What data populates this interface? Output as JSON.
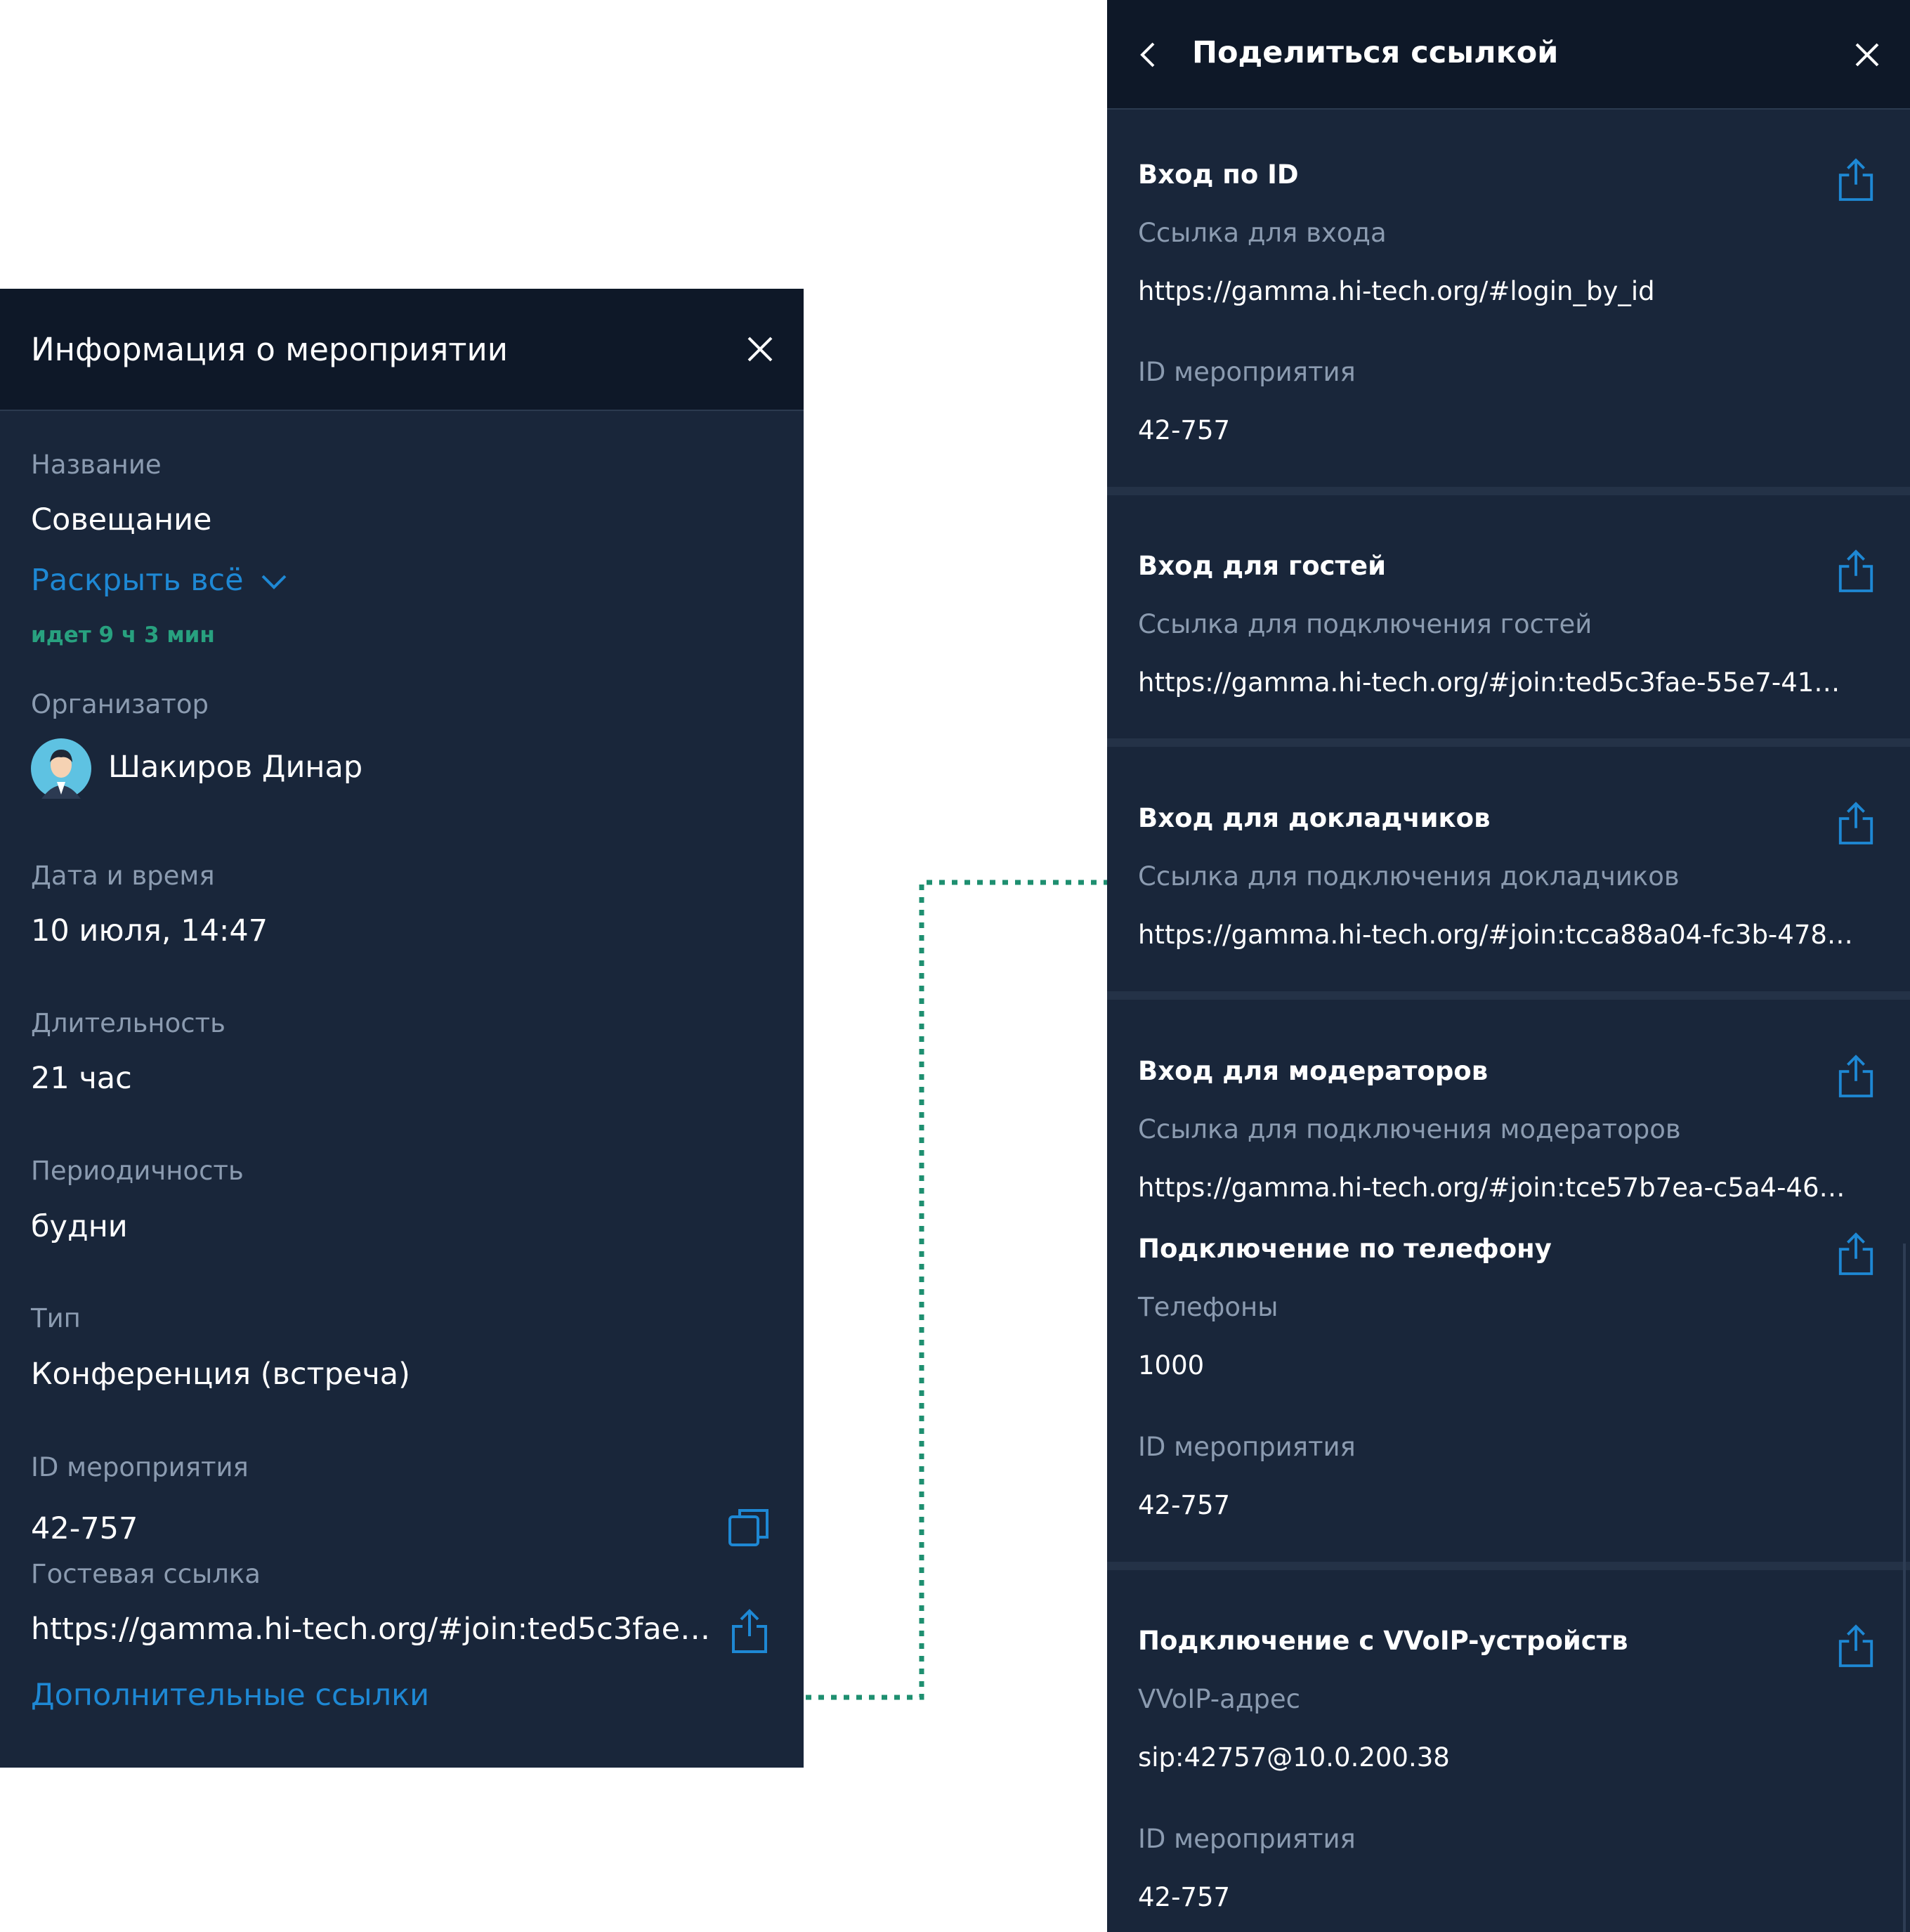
{
  "colors": {
    "panel_bg": "#19263a",
    "header_bg": "#0e1828",
    "accent": "#1e88d4",
    "connector": "#1e8f70",
    "status": "#28a17f"
  },
  "left_panel": {
    "title": "Информация о мероприятии",
    "name_label": "Название",
    "name_value": "Совещание",
    "expand_link": "Раскрыть всё",
    "status": "идет 9 ч 3 мин",
    "organizer_label": "Организатор",
    "organizer_name": "Шакиров Динар",
    "datetime_label": "Дата и время",
    "datetime_value": "10 июля, 14:47",
    "duration_label": "Длительность",
    "duration_value": "21 час",
    "periodicity_label": "Периодичность",
    "periodicity_value": "будни",
    "type_label": "Тип",
    "type_value": "Конференция (встреча)",
    "event_id_label": "ID мероприятия",
    "event_id_value": "42-757",
    "guest_link_label": "Гостевая ссылка",
    "guest_link_value": "https://gamma.hi-tech.org/#join:ted5c3fae-55e7...",
    "more_links": "Дополнительные ссылки"
  },
  "right_panel": {
    "title": "Поделиться ссылкой",
    "sections": [
      {
        "title": "Вход по ID",
        "label1": "Ссылка для входа",
        "value1": "https://gamma.hi-tech.org/#login_by_id",
        "label2": "ID мероприятия",
        "value2": "42-757"
      },
      {
        "title": "Вход для гостей",
        "label1": "Ссылка для подключения гостей",
        "value1": "https://gamma.hi-tech.org/#join:ted5c3fae-55e7-41d9-8..."
      },
      {
        "title": "Вход для докладчиков",
        "label1": "Ссылка для подключения докладчиков",
        "value1": "https://gamma.hi-tech.org/#join:tcca88a04-fc3b-4783-8..."
      },
      {
        "title": "Вход для модераторов",
        "label1": "Ссылка для подключения модераторов",
        "value1": "https://gamma.hi-tech.org/#join:tce57b7ea-c5a4-46d7-a..."
      },
      {
        "title": "Подключение по телефону",
        "label1": "Телефоны",
        "value1": "1000",
        "label2": "ID мероприятия",
        "value2": "42-757"
      },
      {
        "title": "Подключение с VVoIP-устройств",
        "label1": "VVoIP-адрес",
        "value1": "sip:42757@10.0.200.38",
        "label2": "ID мероприятия",
        "value2": "42-757"
      }
    ]
  }
}
